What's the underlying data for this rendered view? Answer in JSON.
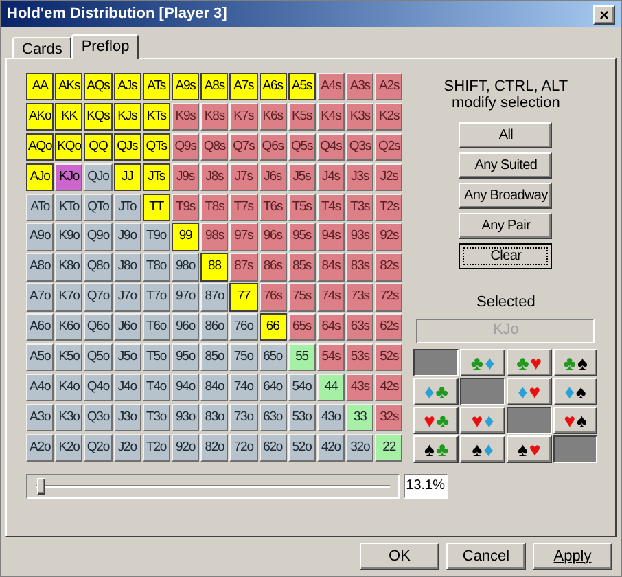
{
  "window": {
    "title": "Hold'em Distribution [Player 3]",
    "close": "×"
  },
  "tabs": [
    {
      "label": "Cards",
      "selected": false
    },
    {
      "label": "Preflop",
      "selected": true
    }
  ],
  "grid": [
    [
      {
        "label": "AA",
        "kind": "pair",
        "selected": true
      },
      {
        "label": "AKs",
        "kind": "suited",
        "selected": true
      },
      {
        "label": "AQs",
        "kind": "suited",
        "selected": true
      },
      {
        "label": "AJs",
        "kind": "suited",
        "selected": true
      },
      {
        "label": "ATs",
        "kind": "suited",
        "selected": true
      },
      {
        "label": "A9s",
        "kind": "suited",
        "selected": true
      },
      {
        "label": "A8s",
        "kind": "suited",
        "selected": true
      },
      {
        "label": "A7s",
        "kind": "suited",
        "selected": true
      },
      {
        "label": "A6s",
        "kind": "suited",
        "selected": true
      },
      {
        "label": "A5s",
        "kind": "suited",
        "selected": true
      },
      {
        "label": "A4s",
        "kind": "suited",
        "selected": false
      },
      {
        "label": "A3s",
        "kind": "suited",
        "selected": false
      },
      {
        "label": "A2s",
        "kind": "suited",
        "selected": false
      }
    ],
    [
      {
        "label": "AKo",
        "kind": "offsuit",
        "selected": true
      },
      {
        "label": "KK",
        "kind": "pair",
        "selected": true
      },
      {
        "label": "KQs",
        "kind": "suited",
        "selected": true
      },
      {
        "label": "KJs",
        "kind": "suited",
        "selected": true
      },
      {
        "label": "KTs",
        "kind": "suited",
        "selected": true
      },
      {
        "label": "K9s",
        "kind": "suited",
        "selected": false
      },
      {
        "label": "K8s",
        "kind": "suited",
        "selected": false
      },
      {
        "label": "K7s",
        "kind": "suited",
        "selected": false
      },
      {
        "label": "K6s",
        "kind": "suited",
        "selected": false
      },
      {
        "label": "K5s",
        "kind": "suited",
        "selected": false
      },
      {
        "label": "K4s",
        "kind": "suited",
        "selected": false
      },
      {
        "label": "K3s",
        "kind": "suited",
        "selected": false
      },
      {
        "label": "K2s",
        "kind": "suited",
        "selected": false
      }
    ],
    [
      {
        "label": "AQo",
        "kind": "offsuit",
        "selected": true
      },
      {
        "label": "KQo",
        "kind": "offsuit",
        "selected": true
      },
      {
        "label": "QQ",
        "kind": "pair",
        "selected": true
      },
      {
        "label": "QJs",
        "kind": "suited",
        "selected": true
      },
      {
        "label": "QTs",
        "kind": "suited",
        "selected": true
      },
      {
        "label": "Q9s",
        "kind": "suited",
        "selected": false
      },
      {
        "label": "Q8s",
        "kind": "suited",
        "selected": false
      },
      {
        "label": "Q7s",
        "kind": "suited",
        "selected": false
      },
      {
        "label": "Q6s",
        "kind": "suited",
        "selected": false
      },
      {
        "label": "Q5s",
        "kind": "suited",
        "selected": false
      },
      {
        "label": "Q4s",
        "kind": "suited",
        "selected": false
      },
      {
        "label": "Q3s",
        "kind": "suited",
        "selected": false
      },
      {
        "label": "Q2s",
        "kind": "suited",
        "selected": false
      }
    ],
    [
      {
        "label": "AJo",
        "kind": "offsuit",
        "selected": true
      },
      {
        "label": "KJo",
        "kind": "offsuit",
        "selected": false,
        "current": true
      },
      {
        "label": "QJo",
        "kind": "offsuit",
        "selected": false
      },
      {
        "label": "JJ",
        "kind": "pair",
        "selected": true
      },
      {
        "label": "JTs",
        "kind": "suited",
        "selected": true
      },
      {
        "label": "J9s",
        "kind": "suited",
        "selected": false
      },
      {
        "label": "J8s",
        "kind": "suited",
        "selected": false
      },
      {
        "label": "J7s",
        "kind": "suited",
        "selected": false
      },
      {
        "label": "J6s",
        "kind": "suited",
        "selected": false
      },
      {
        "label": "J5s",
        "kind": "suited",
        "selected": false
      },
      {
        "label": "J4s",
        "kind": "suited",
        "selected": false
      },
      {
        "label": "J3s",
        "kind": "suited",
        "selected": false
      },
      {
        "label": "J2s",
        "kind": "suited",
        "selected": false
      }
    ],
    [
      {
        "label": "ATo",
        "kind": "offsuit",
        "selected": false
      },
      {
        "label": "KTo",
        "kind": "offsuit",
        "selected": false
      },
      {
        "label": "QTo",
        "kind": "offsuit",
        "selected": false
      },
      {
        "label": "JTo",
        "kind": "offsuit",
        "selected": false
      },
      {
        "label": "TT",
        "kind": "pair",
        "selected": true
      },
      {
        "label": "T9s",
        "kind": "suited",
        "selected": false
      },
      {
        "label": "T8s",
        "kind": "suited",
        "selected": false
      },
      {
        "label": "T7s",
        "kind": "suited",
        "selected": false
      },
      {
        "label": "T6s",
        "kind": "suited",
        "selected": false
      },
      {
        "label": "T5s",
        "kind": "suited",
        "selected": false
      },
      {
        "label": "T4s",
        "kind": "suited",
        "selected": false
      },
      {
        "label": "T3s",
        "kind": "suited",
        "selected": false
      },
      {
        "label": "T2s",
        "kind": "suited",
        "selected": false
      }
    ],
    [
      {
        "label": "A9o",
        "kind": "offsuit",
        "selected": false
      },
      {
        "label": "K9o",
        "kind": "offsuit",
        "selected": false
      },
      {
        "label": "Q9o",
        "kind": "offsuit",
        "selected": false
      },
      {
        "label": "J9o",
        "kind": "offsuit",
        "selected": false
      },
      {
        "label": "T9o",
        "kind": "offsuit",
        "selected": false
      },
      {
        "label": "99",
        "kind": "pair",
        "selected": true
      },
      {
        "label": "98s",
        "kind": "suited",
        "selected": false
      },
      {
        "label": "97s",
        "kind": "suited",
        "selected": false
      },
      {
        "label": "96s",
        "kind": "suited",
        "selected": false
      },
      {
        "label": "95s",
        "kind": "suited",
        "selected": false
      },
      {
        "label": "94s",
        "kind": "suited",
        "selected": false
      },
      {
        "label": "93s",
        "kind": "suited",
        "selected": false
      },
      {
        "label": "92s",
        "kind": "suited",
        "selected": false
      }
    ],
    [
      {
        "label": "A8o",
        "kind": "offsuit",
        "selected": false
      },
      {
        "label": "K8o",
        "kind": "offsuit",
        "selected": false
      },
      {
        "label": "Q8o",
        "kind": "offsuit",
        "selected": false
      },
      {
        "label": "J8o",
        "kind": "offsuit",
        "selected": false
      },
      {
        "label": "T8o",
        "kind": "offsuit",
        "selected": false
      },
      {
        "label": "98o",
        "kind": "offsuit",
        "selected": false
      },
      {
        "label": "88",
        "kind": "pair",
        "selected": true
      },
      {
        "label": "87s",
        "kind": "suited",
        "selected": false
      },
      {
        "label": "86s",
        "kind": "suited",
        "selected": false
      },
      {
        "label": "85s",
        "kind": "suited",
        "selected": false
      },
      {
        "label": "84s",
        "kind": "suited",
        "selected": false
      },
      {
        "label": "83s",
        "kind": "suited",
        "selected": false
      },
      {
        "label": "82s",
        "kind": "suited",
        "selected": false
      }
    ],
    [
      {
        "label": "A7o",
        "kind": "offsuit",
        "selected": false
      },
      {
        "label": "K7o",
        "kind": "offsuit",
        "selected": false
      },
      {
        "label": "Q7o",
        "kind": "offsuit",
        "selected": false
      },
      {
        "label": "J7o",
        "kind": "offsuit",
        "selected": false
      },
      {
        "label": "T7o",
        "kind": "offsuit",
        "selected": false
      },
      {
        "label": "97o",
        "kind": "offsuit",
        "selected": false
      },
      {
        "label": "87o",
        "kind": "offsuit",
        "selected": false
      },
      {
        "label": "77",
        "kind": "pair",
        "selected": true
      },
      {
        "label": "76s",
        "kind": "suited",
        "selected": false
      },
      {
        "label": "75s",
        "kind": "suited",
        "selected": false
      },
      {
        "label": "74s",
        "kind": "suited",
        "selected": false
      },
      {
        "label": "73s",
        "kind": "suited",
        "selected": false
      },
      {
        "label": "72s",
        "kind": "suited",
        "selected": false
      }
    ],
    [
      {
        "label": "A6o",
        "kind": "offsuit",
        "selected": false
      },
      {
        "label": "K6o",
        "kind": "offsuit",
        "selected": false
      },
      {
        "label": "Q6o",
        "kind": "offsuit",
        "selected": false
      },
      {
        "label": "J6o",
        "kind": "offsuit",
        "selected": false
      },
      {
        "label": "T6o",
        "kind": "offsuit",
        "selected": false
      },
      {
        "label": "96o",
        "kind": "offsuit",
        "selected": false
      },
      {
        "label": "86o",
        "kind": "offsuit",
        "selected": false
      },
      {
        "label": "76o",
        "kind": "offsuit",
        "selected": false
      },
      {
        "label": "66",
        "kind": "pair",
        "selected": true
      },
      {
        "label": "65s",
        "kind": "suited",
        "selected": false
      },
      {
        "label": "64s",
        "kind": "suited",
        "selected": false
      },
      {
        "label": "63s",
        "kind": "suited",
        "selected": false
      },
      {
        "label": "62s",
        "kind": "suited",
        "selected": false
      }
    ],
    [
      {
        "label": "A5o",
        "kind": "offsuit",
        "selected": false
      },
      {
        "label": "K5o",
        "kind": "offsuit",
        "selected": false
      },
      {
        "label": "Q5o",
        "kind": "offsuit",
        "selected": false
      },
      {
        "label": "J5o",
        "kind": "offsuit",
        "selected": false
      },
      {
        "label": "T5o",
        "kind": "offsuit",
        "selected": false
      },
      {
        "label": "95o",
        "kind": "offsuit",
        "selected": false
      },
      {
        "label": "85o",
        "kind": "offsuit",
        "selected": false
      },
      {
        "label": "75o",
        "kind": "offsuit",
        "selected": false
      },
      {
        "label": "65o",
        "kind": "offsuit",
        "selected": false
      },
      {
        "label": "55",
        "kind": "pair",
        "selected": false
      },
      {
        "label": "54s",
        "kind": "suited",
        "selected": false
      },
      {
        "label": "53s",
        "kind": "suited",
        "selected": false
      },
      {
        "label": "52s",
        "kind": "suited",
        "selected": false
      }
    ],
    [
      {
        "label": "A4o",
        "kind": "offsuit",
        "selected": false
      },
      {
        "label": "K4o",
        "kind": "offsuit",
        "selected": false
      },
      {
        "label": "Q4o",
        "kind": "offsuit",
        "selected": false
      },
      {
        "label": "J4o",
        "kind": "offsuit",
        "selected": false
      },
      {
        "label": "T4o",
        "kind": "offsuit",
        "selected": false
      },
      {
        "label": "94o",
        "kind": "offsuit",
        "selected": false
      },
      {
        "label": "84o",
        "kind": "offsuit",
        "selected": false
      },
      {
        "label": "74o",
        "kind": "offsuit",
        "selected": false
      },
      {
        "label": "64o",
        "kind": "offsuit",
        "selected": false
      },
      {
        "label": "54o",
        "kind": "offsuit",
        "selected": false
      },
      {
        "label": "44",
        "kind": "pair",
        "selected": false
      },
      {
        "label": "43s",
        "kind": "suited",
        "selected": false
      },
      {
        "label": "42s",
        "kind": "suited",
        "selected": false
      }
    ],
    [
      {
        "label": "A3o",
        "kind": "offsuit",
        "selected": false
      },
      {
        "label": "K3o",
        "kind": "offsuit",
        "selected": false
      },
      {
        "label": "Q3o",
        "kind": "offsuit",
        "selected": false
      },
      {
        "label": "J3o",
        "kind": "offsuit",
        "selected": false
      },
      {
        "label": "T3o",
        "kind": "offsuit",
        "selected": false
      },
      {
        "label": "93o",
        "kind": "offsuit",
        "selected": false
      },
      {
        "label": "83o",
        "kind": "offsuit",
        "selected": false
      },
      {
        "label": "73o",
        "kind": "offsuit",
        "selected": false
      },
      {
        "label": "63o",
        "kind": "offsuit",
        "selected": false
      },
      {
        "label": "53o",
        "kind": "offsuit",
        "selected": false
      },
      {
        "label": "43o",
        "kind": "offsuit",
        "selected": false
      },
      {
        "label": "33",
        "kind": "pair",
        "selected": false
      },
      {
        "label": "32s",
        "kind": "suited",
        "selected": false
      }
    ],
    [
      {
        "label": "A2o",
        "kind": "offsuit",
        "selected": false
      },
      {
        "label": "K2o",
        "kind": "offsuit",
        "selected": false
      },
      {
        "label": "Q2o",
        "kind": "offsuit",
        "selected": false
      },
      {
        "label": "J2o",
        "kind": "offsuit",
        "selected": false
      },
      {
        "label": "T2o",
        "kind": "offsuit",
        "selected": false
      },
      {
        "label": "92o",
        "kind": "offsuit",
        "selected": false
      },
      {
        "label": "82o",
        "kind": "offsuit",
        "selected": false
      },
      {
        "label": "72o",
        "kind": "offsuit",
        "selected": false
      },
      {
        "label": "62o",
        "kind": "offsuit",
        "selected": false
      },
      {
        "label": "52o",
        "kind": "offsuit",
        "selected": false
      },
      {
        "label": "42o",
        "kind": "offsuit",
        "selected": false
      },
      {
        "label": "32o",
        "kind": "offsuit",
        "selected": false
      },
      {
        "label": "22",
        "kind": "pair",
        "selected": false
      }
    ]
  ],
  "hint": [
    "SHIFT, CTRL, ALT",
    "modify selection"
  ],
  "buttons": [
    {
      "label": "All",
      "focused": false
    },
    {
      "label": "Any Suited",
      "focused": false
    },
    {
      "label": "Any Broadway",
      "focused": false
    },
    {
      "label": "Any Pair",
      "focused": false
    },
    {
      "label": "Clear",
      "focused": true
    }
  ],
  "selected_label": "Selected",
  "selected_value": "KJo",
  "combos": [
    [
      {
        "kind": "blank"
      },
      {
        "kind": "combo",
        "suits": [
          {
            "glyph": "♣",
            "color": "#1f9a1f"
          },
          {
            "glyph": "♦",
            "color": "#2aa0d8"
          }
        ]
      },
      {
        "kind": "combo",
        "suits": [
          {
            "glyph": "♣",
            "color": "#1f9a1f"
          },
          {
            "glyph": "♥",
            "color": "#e81010"
          }
        ]
      },
      {
        "kind": "combo",
        "suits": [
          {
            "glyph": "♣",
            "color": "#1f9a1f"
          },
          {
            "glyph": "♠",
            "color": "#000000"
          }
        ]
      }
    ],
    [
      {
        "kind": "combo",
        "suits": [
          {
            "glyph": "♦",
            "color": "#2aa0d8"
          },
          {
            "glyph": "♣",
            "color": "#1f9a1f"
          }
        ]
      },
      {
        "kind": "blank"
      },
      {
        "kind": "combo",
        "suits": [
          {
            "glyph": "♦",
            "color": "#2aa0d8"
          },
          {
            "glyph": "♥",
            "color": "#e81010"
          }
        ]
      },
      {
        "kind": "combo",
        "suits": [
          {
            "glyph": "♦",
            "color": "#2aa0d8"
          },
          {
            "glyph": "♠",
            "color": "#000000"
          }
        ]
      }
    ],
    [
      {
        "kind": "combo",
        "suits": [
          {
            "glyph": "♥",
            "color": "#e81010"
          },
          {
            "glyph": "♣",
            "color": "#1f9a1f"
          }
        ]
      },
      {
        "kind": "combo",
        "suits": [
          {
            "glyph": "♥",
            "color": "#e81010"
          },
          {
            "glyph": "♦",
            "color": "#2aa0d8"
          }
        ]
      },
      {
        "kind": "blank"
      },
      {
        "kind": "combo",
        "suits": [
          {
            "glyph": "♥",
            "color": "#e81010"
          },
          {
            "glyph": "♠",
            "color": "#000000"
          }
        ]
      }
    ],
    [
      {
        "kind": "combo",
        "suits": [
          {
            "glyph": "♠",
            "color": "#000000"
          },
          {
            "glyph": "♣",
            "color": "#1f9a1f"
          }
        ]
      },
      {
        "kind": "combo",
        "suits": [
          {
            "glyph": "♠",
            "color": "#000000"
          },
          {
            "glyph": "♦",
            "color": "#2aa0d8"
          }
        ]
      },
      {
        "kind": "combo",
        "suits": [
          {
            "glyph": "♠",
            "color": "#000000"
          },
          {
            "glyph": "♥",
            "color": "#e81010"
          }
        ]
      },
      {
        "kind": "blank"
      }
    ]
  ],
  "slider": {
    "level": 0.013
  },
  "percent": "13.1%",
  "footer_buttons": [
    {
      "label": "OK",
      "kind": "plain"
    },
    {
      "label": "Cancel",
      "kind": "plain"
    },
    {
      "label": "Apply",
      "kind": "mnemonic"
    }
  ]
}
